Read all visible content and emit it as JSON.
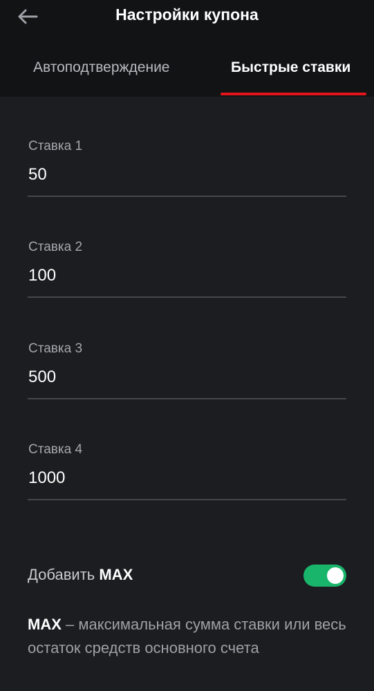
{
  "header": {
    "back_icon": "arrow-left-icon",
    "title": "Настройки купона"
  },
  "tabs": [
    {
      "label": "Автоподтверждение",
      "active": false
    },
    {
      "label": "Быстрые ставки",
      "active": true
    }
  ],
  "bets": [
    {
      "label": "Ставка 1",
      "value": "50"
    },
    {
      "label": "Ставка 2",
      "value": "100"
    },
    {
      "label": "Ставка 3",
      "value": "500"
    },
    {
      "label": "Ставка 4",
      "value": "1000"
    }
  ],
  "max_toggle": {
    "label_prefix": "Добавить",
    "label_bold": "MAX",
    "enabled": true
  },
  "description": {
    "term": "MAX",
    "text": " – максимальная сумма ставки или весь остаток средств основного счета"
  },
  "colors": {
    "accent": "#e3141b",
    "toggle_on": "#19b56b",
    "background": "#1c1d21",
    "header_background": "#121315"
  }
}
